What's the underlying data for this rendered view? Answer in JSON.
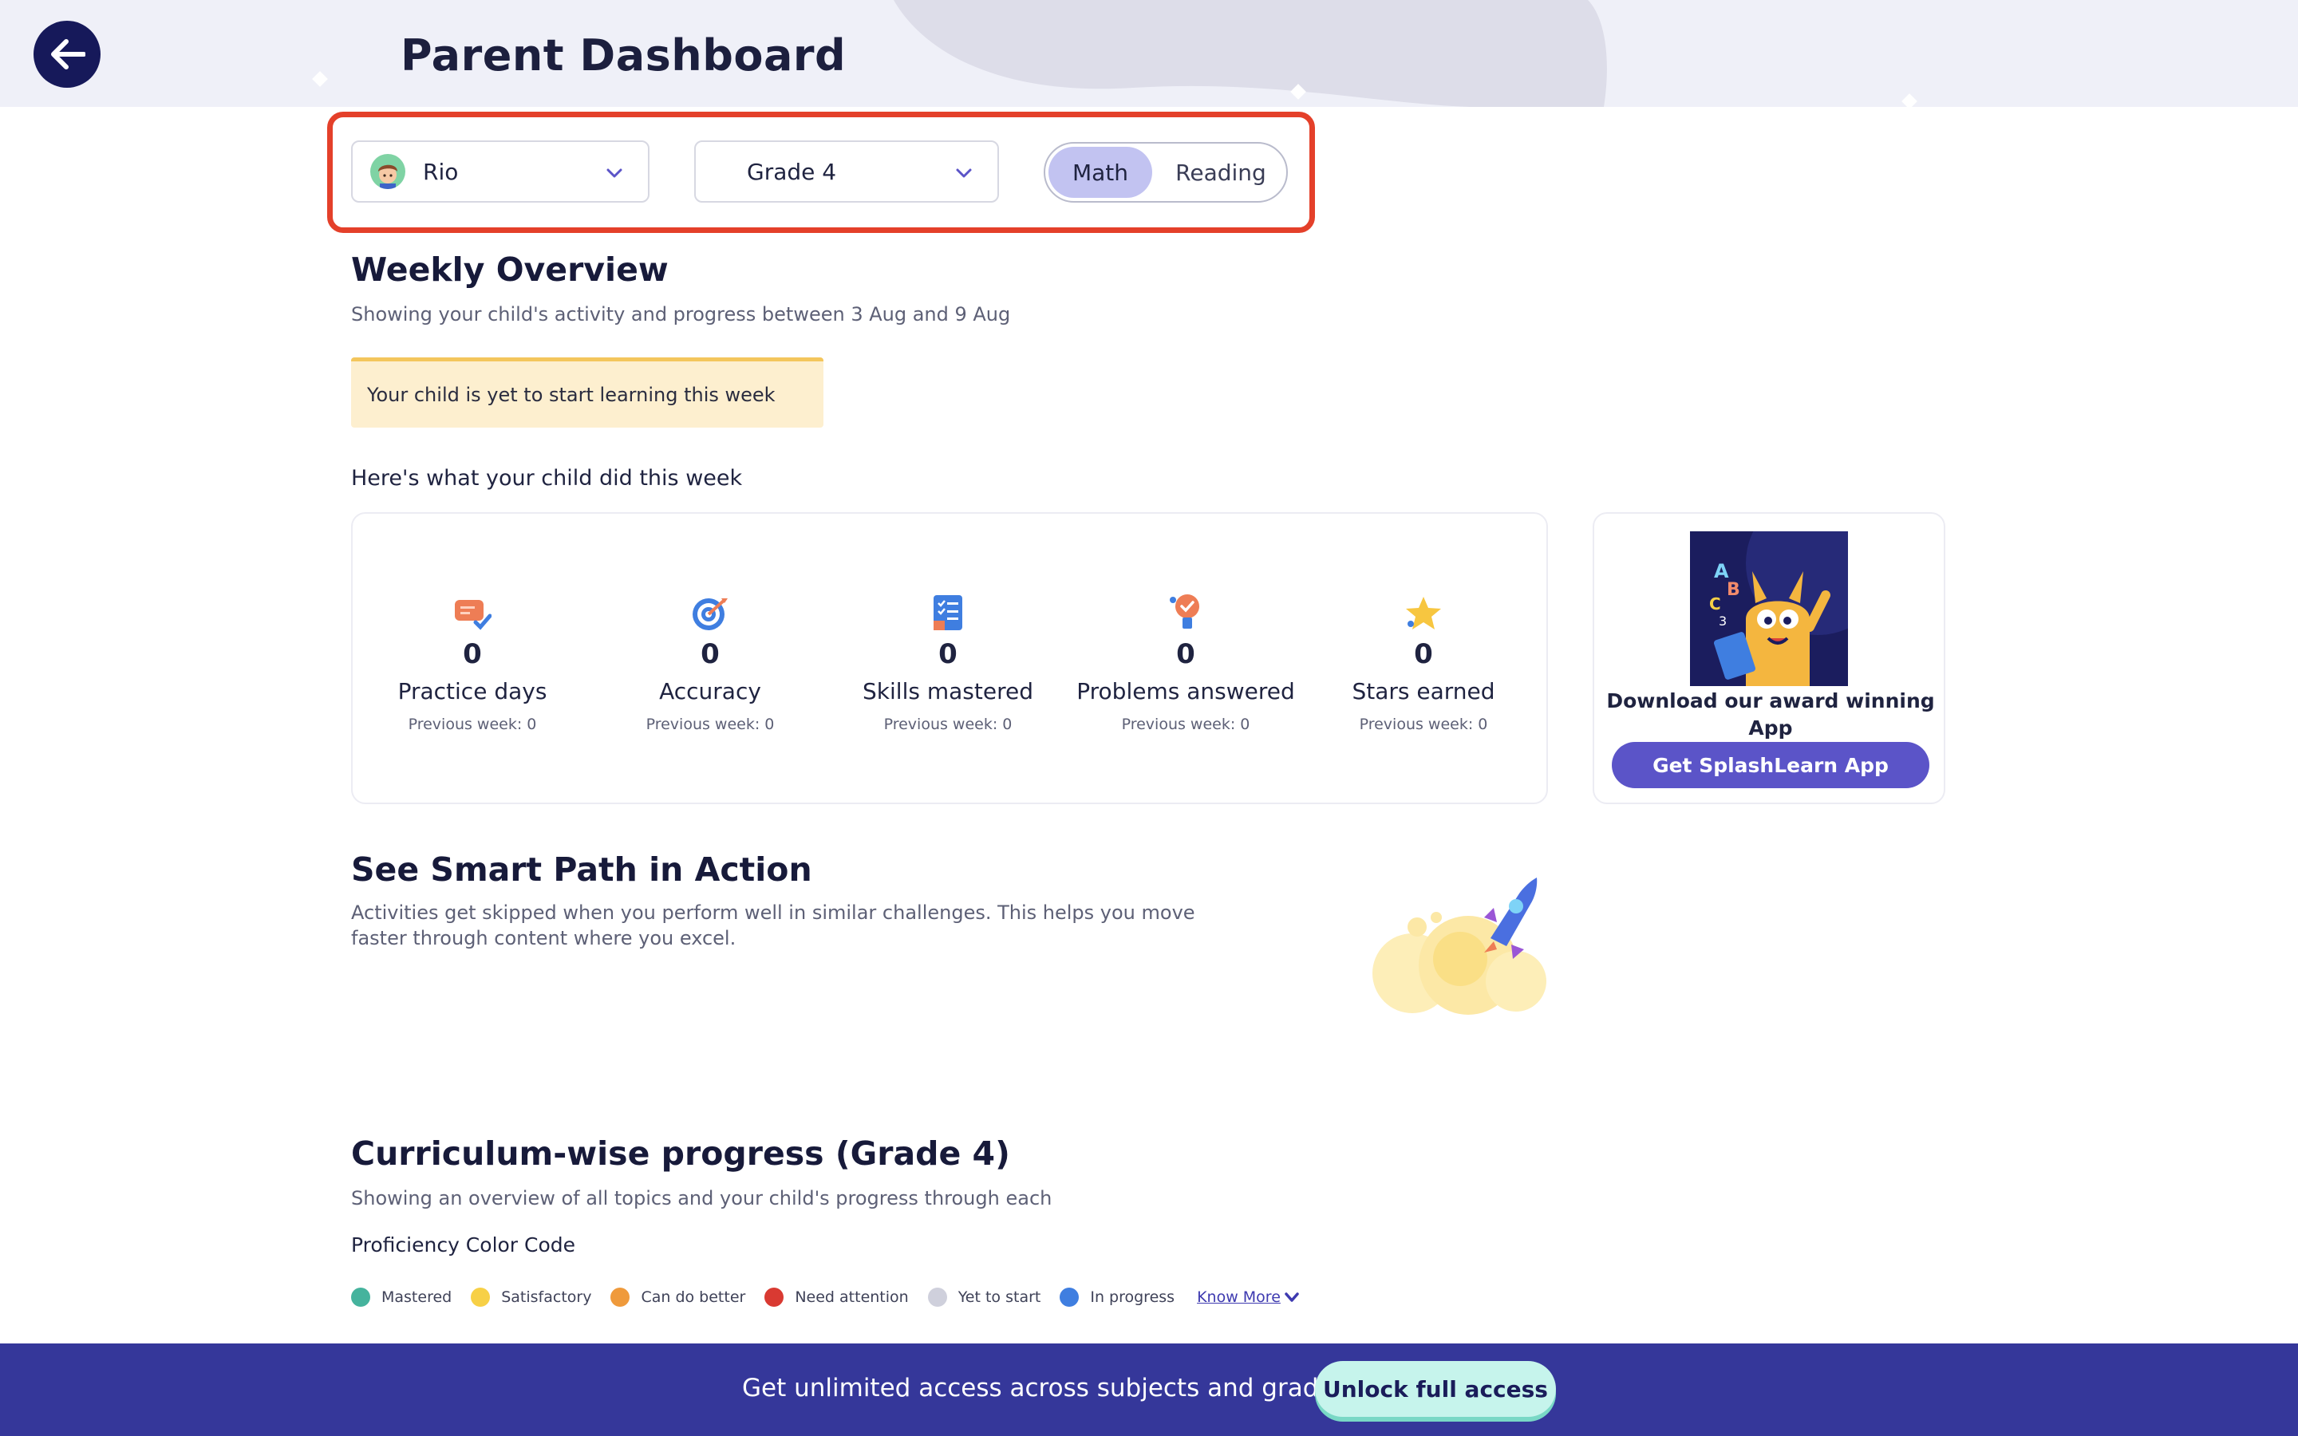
{
  "header": {
    "title": "Parent Dashboard",
    "back_icon": "arrow-left-icon"
  },
  "filters": {
    "child": {
      "name": "Rio",
      "icon": "boy-avatar-icon"
    },
    "grade": {
      "value": "Grade 4"
    },
    "subjects": [
      {
        "label": "Math",
        "selected": true
      },
      {
        "label": "Reading",
        "selected": false
      }
    ]
  },
  "weekly": {
    "title": "Weekly Overview",
    "subtitle": "Showing your child's activity and progress between 3 Aug and 9 Aug",
    "notice": "Your child is yet to start learning this week",
    "did_label": "Here's what your child did this week",
    "stats": [
      {
        "icon": "chat-check-icon",
        "value": "0",
        "label": "Practice days",
        "previous": "Previous week: 0"
      },
      {
        "icon": "target-icon",
        "value": "0",
        "label": "Accuracy",
        "previous": "Previous week: 0"
      },
      {
        "icon": "checklist-icon",
        "value": "0",
        "label": "Skills mastered",
        "previous": "Previous week: 0"
      },
      {
        "icon": "lightbulb-icon",
        "value": "0",
        "label": "Problems answered",
        "previous": "Previous week: 0"
      },
      {
        "icon": "star-icon",
        "value": "0",
        "label": "Stars earned",
        "previous": "Previous week: 0"
      }
    ]
  },
  "app_promo": {
    "text": "Download our award winning App",
    "button": "Get SplashLearn App"
  },
  "smart_path": {
    "title": "See Smart Path in Action",
    "description": "Activities get skipped when you perform well in similar challenges. This helps you move faster through content where you excel."
  },
  "curriculum": {
    "title": "Curriculum-wise progress (Grade 4)",
    "subtitle": "Showing an overview of all topics and your child's progress through each",
    "proficiency_label": "Proficiency Color Code",
    "legend": [
      {
        "label": "Mastered",
        "color": "#45b39d"
      },
      {
        "label": "Satisfactory",
        "color": "#f7d046"
      },
      {
        "label": "Can do better",
        "color": "#ef9a3c"
      },
      {
        "label": "Need attention",
        "color": "#d93a32"
      },
      {
        "label": "Yet to start",
        "color": "#cfd0dc"
      },
      {
        "label": "In progress",
        "color": "#3f7ee0"
      }
    ],
    "know_more": "Know More"
  },
  "footer": {
    "text": "Get unlimited access across subjects and grades.",
    "button": "Unlock full access"
  },
  "colors": {
    "accent": "#5b54c8",
    "highlight_border": "#e4402a",
    "footer_bg": "#35379a"
  }
}
